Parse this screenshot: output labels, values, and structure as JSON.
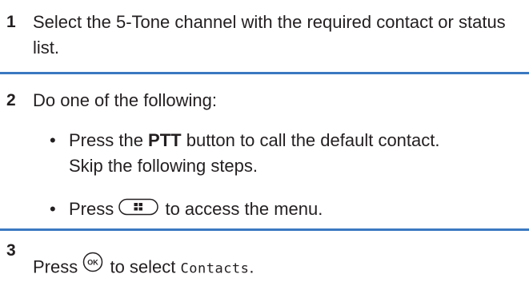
{
  "steps": [
    {
      "number": "1",
      "text": "Select the 5-Tone channel with the required contact or status list."
    },
    {
      "number": "2",
      "text": "Do one of the following:",
      "options": [
        {
          "before": "Press the ",
          "bold": "PTT",
          "after": " button to call the default contact.",
          "line2": "Skip the following steps."
        },
        {
          "before": "Press ",
          "icon": "menu-button-icon",
          "after": " to access the menu."
        }
      ]
    },
    {
      "number": "3",
      "before": "Press ",
      "icon": "ok-button-icon",
      "icon_label": "OK",
      "middle": " to select ",
      "mono": "Contacts",
      "after": "."
    }
  ],
  "colors": {
    "divider": "#3b79c1",
    "text": "#231f20"
  }
}
